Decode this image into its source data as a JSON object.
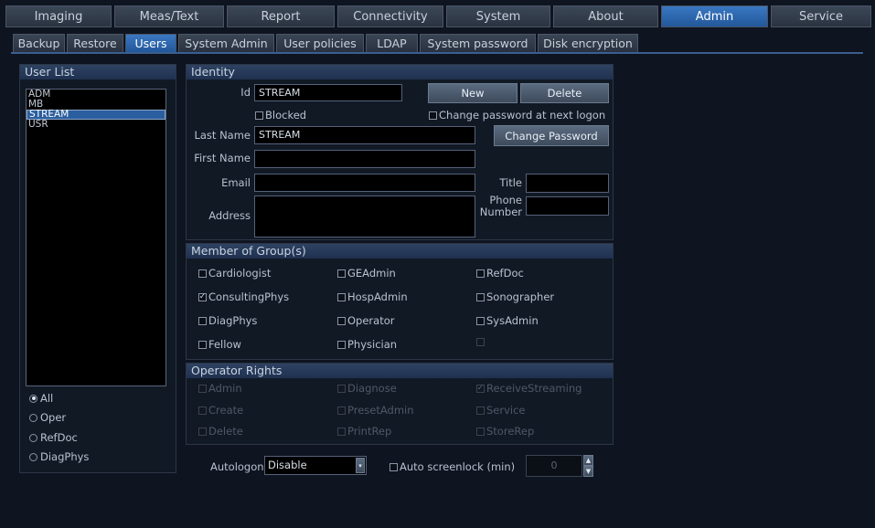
{
  "top_tabs": [
    {
      "label": "Imaging",
      "active": false
    },
    {
      "label": "Meas/Text",
      "active": false
    },
    {
      "label": "Report",
      "active": false
    },
    {
      "label": "Connectivity",
      "active": false
    },
    {
      "label": "System",
      "active": false
    },
    {
      "label": "About",
      "active": false
    },
    {
      "label": "Admin",
      "active": true
    },
    {
      "label": "Service",
      "active": false
    }
  ],
  "sub_tabs": [
    {
      "label": "Backup",
      "active": false
    },
    {
      "label": "Restore",
      "active": false
    },
    {
      "label": "Users",
      "active": true
    },
    {
      "label": "System Admin",
      "active": false
    },
    {
      "label": "User policies",
      "active": false
    },
    {
      "label": "LDAP",
      "active": false
    },
    {
      "label": "System password",
      "active": false
    },
    {
      "label": "Disk encryption",
      "active": false
    }
  ],
  "user_list": {
    "header": "User List",
    "users": [
      "ADM",
      "MB",
      "STREAM",
      "USR"
    ],
    "selected": "STREAM",
    "filters": [
      {
        "label": "All",
        "selected": true
      },
      {
        "label": "Oper",
        "selected": false
      },
      {
        "label": "RefDoc",
        "selected": false
      },
      {
        "label": "DiagPhys",
        "selected": false
      }
    ]
  },
  "identity": {
    "header": "Identity",
    "id_label": "Id",
    "id_value": "STREAM",
    "new_button": "New",
    "delete_button": "Delete",
    "blocked_label": "Blocked",
    "change_pw_next_logon_label": "Change password at next logon",
    "last_name_label": "Last Name",
    "last_name_value": "STREAM",
    "change_password_button": "Change Password",
    "first_name_label": "First Name",
    "first_name_value": "",
    "email_label": "Email",
    "email_value": "",
    "title_label": "Title",
    "title_value": "",
    "phone_label_line1": "Phone",
    "phone_label_line2": "Number",
    "phone_value": "",
    "address_label": "Address",
    "address_value": ""
  },
  "groups": {
    "header": "Member of Group(s)",
    "items": [
      {
        "label": "Cardiologist",
        "checked": false
      },
      {
        "label": "GEAdmin",
        "checked": false
      },
      {
        "label": "RefDoc",
        "checked": false
      },
      {
        "label": "ConsultingPhys",
        "checked": true
      },
      {
        "label": "HospAdmin",
        "checked": false
      },
      {
        "label": "Sonographer",
        "checked": false
      },
      {
        "label": "DiagPhys",
        "checked": false
      },
      {
        "label": "Operator",
        "checked": false
      },
      {
        "label": "SysAdmin",
        "checked": false
      },
      {
        "label": "Fellow",
        "checked": false
      },
      {
        "label": "Physician",
        "checked": false
      },
      {
        "label": "",
        "checked": false
      }
    ]
  },
  "operator_rights": {
    "header": "Operator Rights",
    "items": [
      {
        "label": "Admin",
        "checked": false
      },
      {
        "label": "Diagnose",
        "checked": false
      },
      {
        "label": "ReceiveStreaming",
        "checked": true
      },
      {
        "label": "Create",
        "checked": false
      },
      {
        "label": "PresetAdmin",
        "checked": false
      },
      {
        "label": "Service",
        "checked": false
      },
      {
        "label": "Delete",
        "checked": false
      },
      {
        "label": "PrintRep",
        "checked": false
      },
      {
        "label": "StoreRep",
        "checked": false
      }
    ]
  },
  "footer": {
    "autologon_label": "Autologon",
    "autologon_value": "Disable",
    "auto_screenlock_label": "Auto screenlock (min)",
    "auto_screenlock_value": "0"
  }
}
